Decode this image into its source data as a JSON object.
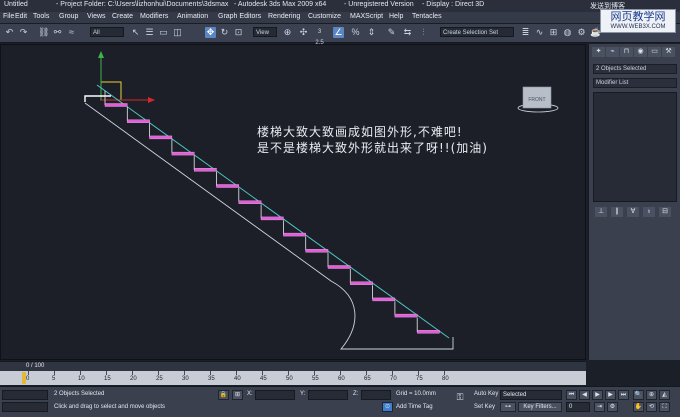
{
  "titlebar": {
    "doc": "Untitled",
    "project": "- Project Folder: C:\\Users\\lizhonhui\\Documents\\3dsmax",
    "app": "- Autodesk 3ds Max  2009 x64",
    "reg": "- Unregistered Version",
    "display": "- Display : Direct 3D",
    "site_small": "发送到博客"
  },
  "watermark": {
    "big": "网页教学网",
    "small": "WWW.WEB3X.COM"
  },
  "menu": [
    "File",
    "Edit",
    "Tools",
    "Group",
    "Views",
    "Create",
    "Modifiers",
    "Animation",
    "Graph Editors",
    "Rendering",
    "Customize",
    "MAXScript",
    "Help",
    "Tentacles"
  ],
  "toolbar": {
    "selection_filter": "All",
    "ref_coord": "View",
    "snap_value": "3  2.5",
    "named_selection": "Create Selection Set"
  },
  "viewport": {
    "annotation_line1": "楼梯大致大致画成如图外形,不难吧!",
    "annotation_line2": "是不是楼梯大致外形就出来了呀!!(加油)",
    "viewcube_label": "FRONT",
    "step_count": 15
  },
  "command_panel": {
    "object_name": "2 Objects Selected",
    "modifier_list": "Modifier List"
  },
  "timeline": {
    "frame_counter": "0 / 100",
    "ticks": [
      "0",
      "5",
      "10",
      "15",
      "20",
      "25",
      "30",
      "35",
      "40",
      "45",
      "50",
      "55",
      "60",
      "65",
      "70",
      "75",
      "80"
    ]
  },
  "status": {
    "selected": "2 Objects Selected",
    "prompt": "Click and drag to select and move objects",
    "x_label": "X:",
    "y_label": "Y:",
    "z_label": "Z:",
    "grid": "Grid = 10.0mm",
    "add_time_tag": "Add Time Tag",
    "auto_key": "Auto Key",
    "auto_key_mode": "Selected",
    "set_key": "Set Key",
    "key_filters": "Key Filters...",
    "frame_field": "0"
  }
}
